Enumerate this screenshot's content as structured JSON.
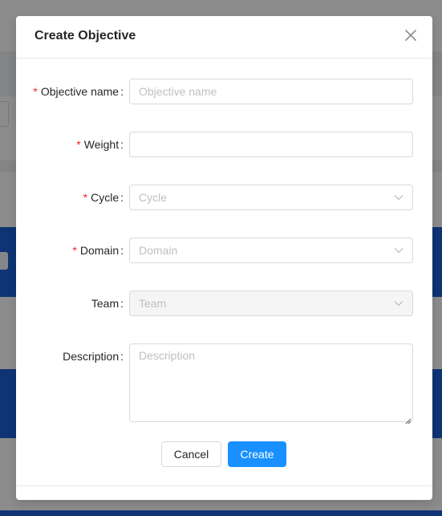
{
  "modal": {
    "title": "Create Objective",
    "close_icon": "close-icon"
  },
  "form": {
    "objective_name": {
      "label": "Objective name",
      "required": true,
      "placeholder": "Objective name",
      "value": ""
    },
    "weight": {
      "label": "Weight",
      "required": true,
      "placeholder": "",
      "value": ""
    },
    "cycle": {
      "label": "Cycle",
      "required": true,
      "placeholder": "Cycle"
    },
    "domain": {
      "label": "Domain",
      "required": true,
      "placeholder": "Domain"
    },
    "team": {
      "label": "Team",
      "required": false,
      "placeholder": "Team",
      "disabled": true
    },
    "description": {
      "label": "Description",
      "required": false,
      "placeholder": "Description",
      "value": ""
    },
    "required_mark": "*",
    "colon": ":"
  },
  "buttons": {
    "cancel_label": "Cancel",
    "create_label": "Create"
  },
  "colors": {
    "primary": "#1890ff",
    "required": "#f5222d",
    "placeholder": "#bfbfbf",
    "background_accent": "#1a5fd6"
  },
  "icons": {
    "select_arrow": "chevron-down-icon",
    "textarea_resize": "resize-grip-icon"
  }
}
